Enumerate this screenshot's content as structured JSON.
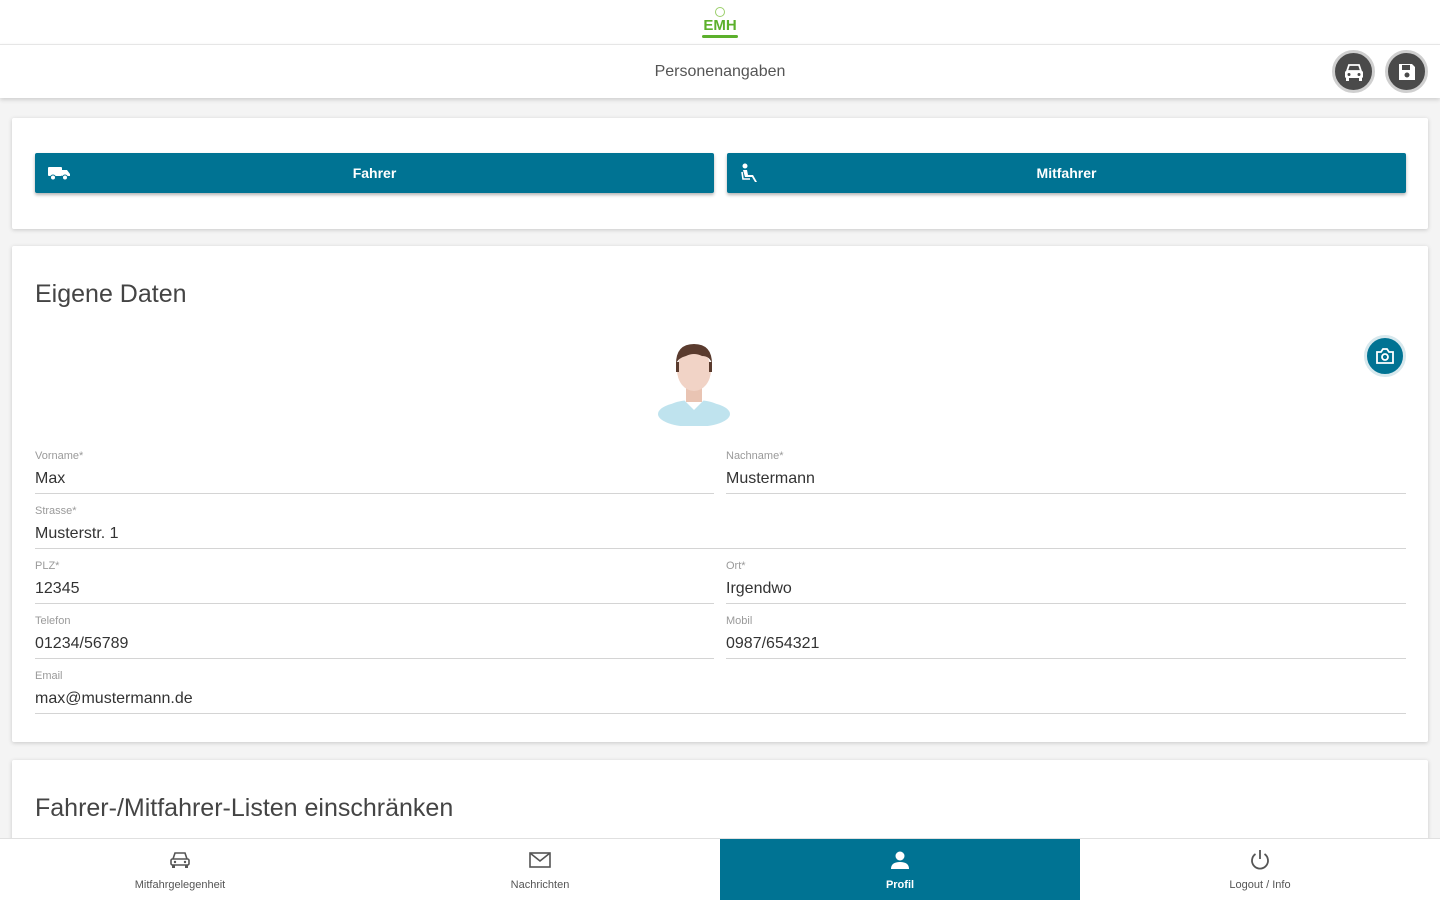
{
  "logo": {
    "text": "EMH"
  },
  "header": {
    "title": "Personenangaben",
    "car_icon": "car-icon",
    "save_icon": "save-icon"
  },
  "roles": {
    "driver": {
      "label": "Fahrer",
      "icon": "truck-icon"
    },
    "passenger": {
      "label": "Mitfahrer",
      "icon": "seated-person-icon"
    }
  },
  "own_data": {
    "title": "Eigene Daten",
    "fields": {
      "vorname": {
        "label": "Vorname*",
        "value": "Max"
      },
      "nachname": {
        "label": "Nachname*",
        "value": "Mustermann"
      },
      "strasse": {
        "label": "Strasse*",
        "value": "Musterstr. 1"
      },
      "plz": {
        "label": "PLZ*",
        "value": "12345"
      },
      "ort": {
        "label": "Ort*",
        "value": "Irgendwo"
      },
      "telefon": {
        "label": "Telefon",
        "value": "01234/56789"
      },
      "mobil": {
        "label": "Mobil",
        "value": "0987/654321"
      },
      "email": {
        "label": "Email",
        "value": "max@mustermann.de"
      }
    }
  },
  "lists": {
    "title": "Fahrer-/Mitfahrer-Listen einschränken"
  },
  "nav": {
    "items": [
      {
        "label": "Mitfahrgelegenheit",
        "icon": "car-icon"
      },
      {
        "label": "Nachrichten",
        "icon": "mail-icon"
      },
      {
        "label": "Profil",
        "icon": "person-icon"
      },
      {
        "label": "Logout / Info",
        "icon": "power-icon"
      }
    ],
    "active_index": 2
  },
  "colors": {
    "primary": "#007393",
    "logo_green": "#5cb02c",
    "dark_button": "#4a4a4a"
  }
}
